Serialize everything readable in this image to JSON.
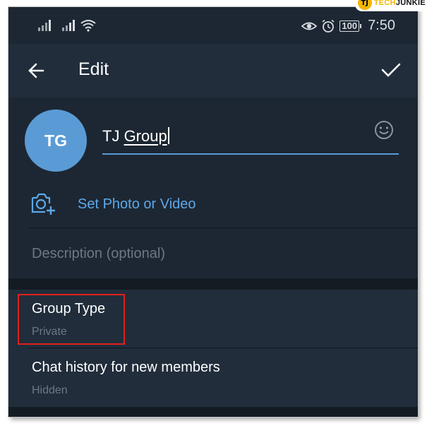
{
  "status_bar": {
    "battery": "100",
    "time": "7:50",
    "icons": [
      "signal-icon",
      "signal-icon",
      "wifi-icon",
      "eye-icon",
      "alarm-icon",
      "battery-icon"
    ]
  },
  "watermark": {
    "logo_text": "TJ",
    "brand_part1": "TECH",
    "brand_part2": "JUNKIE"
  },
  "toolbar": {
    "title": "Edit",
    "back_icon": "arrow-left-icon",
    "confirm_icon": "checkmark-icon"
  },
  "group": {
    "avatar_initials": "TG",
    "name_prefix": "TJ ",
    "name_underlined": "Group",
    "set_photo_label": "Set Photo or Video",
    "description_placeholder": "Description (optional)"
  },
  "settings": [
    {
      "title": "Group Type",
      "value": "Private"
    },
    {
      "title": "Chat history for new members",
      "value": "Hidden"
    }
  ],
  "colors": {
    "background": "#1d2733",
    "header": "#212d3b",
    "accent": "#5b9bd5",
    "link": "#5da8e8",
    "highlight_box": "#e0201a"
  }
}
